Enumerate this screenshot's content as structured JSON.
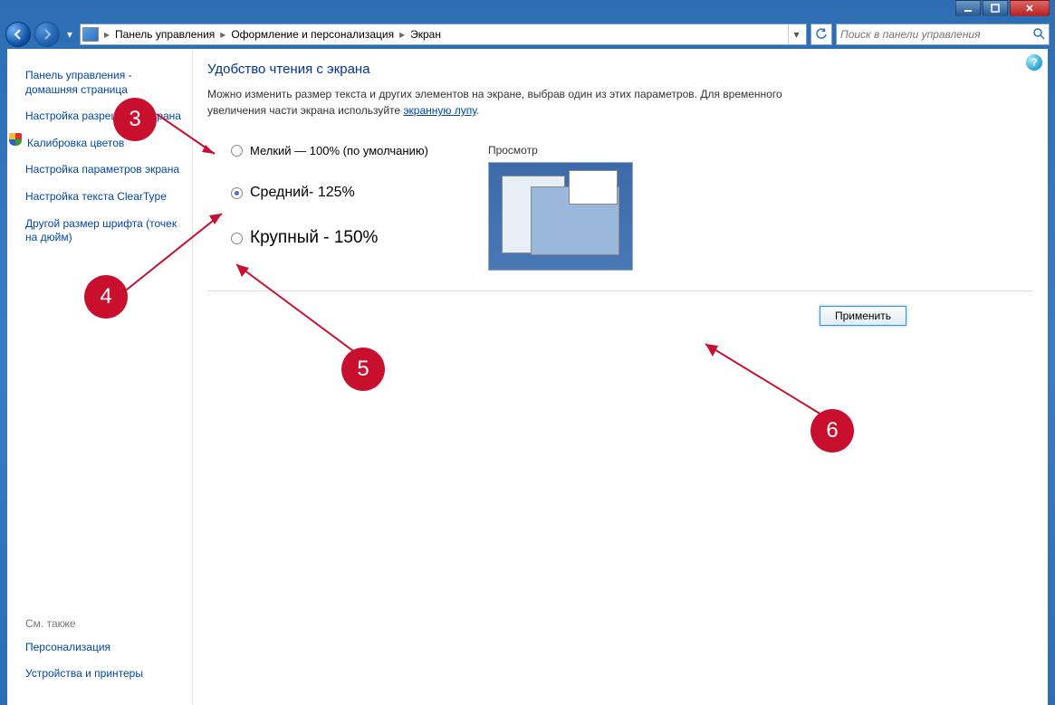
{
  "window": {
    "minimize_tip": "Свернуть",
    "maximize_tip": "Развернуть",
    "close_tip": "Закрыть"
  },
  "breadcrumb": {
    "items": [
      "Панель управления",
      "Оформление и персонализация",
      "Экран"
    ]
  },
  "search": {
    "placeholder": "Поиск в панели управления"
  },
  "sidebar": {
    "items": [
      "Панель управления - домашняя страница",
      "Настройка разрешения экрана",
      "Калибровка цветов",
      "Настройка параметров экрана",
      "Настройка текста ClearType",
      "Другой размер шрифта (точек на дюйм)"
    ],
    "see_also_header": "См. также",
    "see_also": [
      "Персонализация",
      "Устройства и принтеры"
    ]
  },
  "main": {
    "title": "Удобство чтения с экрана",
    "desc_pre": "Можно изменить размер текста и других элементов на экране, выбрав один из этих параметров. Для временного увеличения части экрана используйте ",
    "desc_link": "экранную лупу",
    "desc_post": ".",
    "options": [
      {
        "label": "Мелкий — 100% (по умолчанию)",
        "selected": false
      },
      {
        "label": "Средний- 125%",
        "selected": true
      },
      {
        "label": "Крупный - 150%",
        "selected": false
      }
    ],
    "preview_label": "Просмотр",
    "apply_button": "Применить"
  },
  "annotations": {
    "c3": "3",
    "c4": "4",
    "c5": "5",
    "c6": "6"
  },
  "help_glyph": "?"
}
